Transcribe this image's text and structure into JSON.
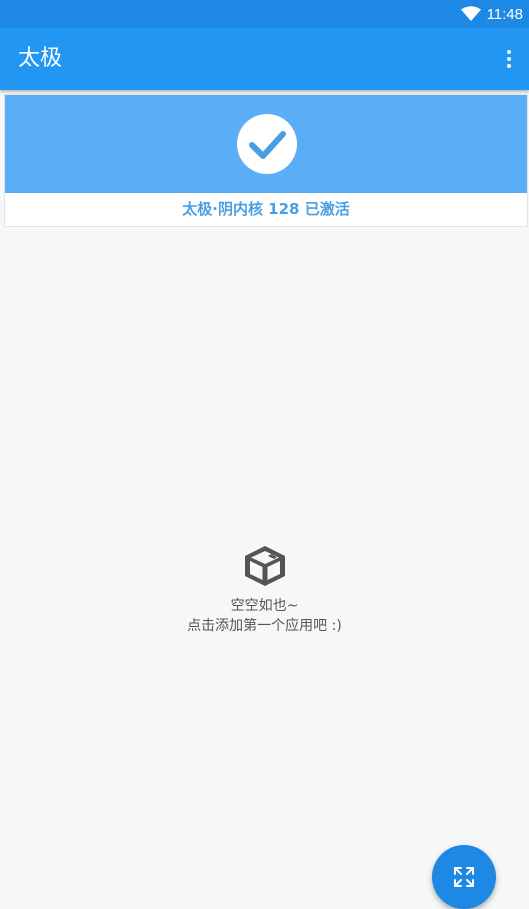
{
  "status_bar": {
    "time": "11:48"
  },
  "app_bar": {
    "title": "太极"
  },
  "status_card": {
    "text": "太极·阴内核 128 已激活"
  },
  "empty_state": {
    "line1": "空空如也~",
    "line2": "点击添加第一个应用吧 :)"
  },
  "icons": {
    "wifi": "wifi-icon",
    "overflow": "more-vert-icon",
    "check": "check-circle-icon",
    "empty": "box-icon",
    "fab": "expand-icon"
  },
  "colors": {
    "primary": "#2196f3",
    "status_bar": "#1e88e5",
    "banner": "#5aaef6",
    "accent_text": "#4a9fe3"
  }
}
